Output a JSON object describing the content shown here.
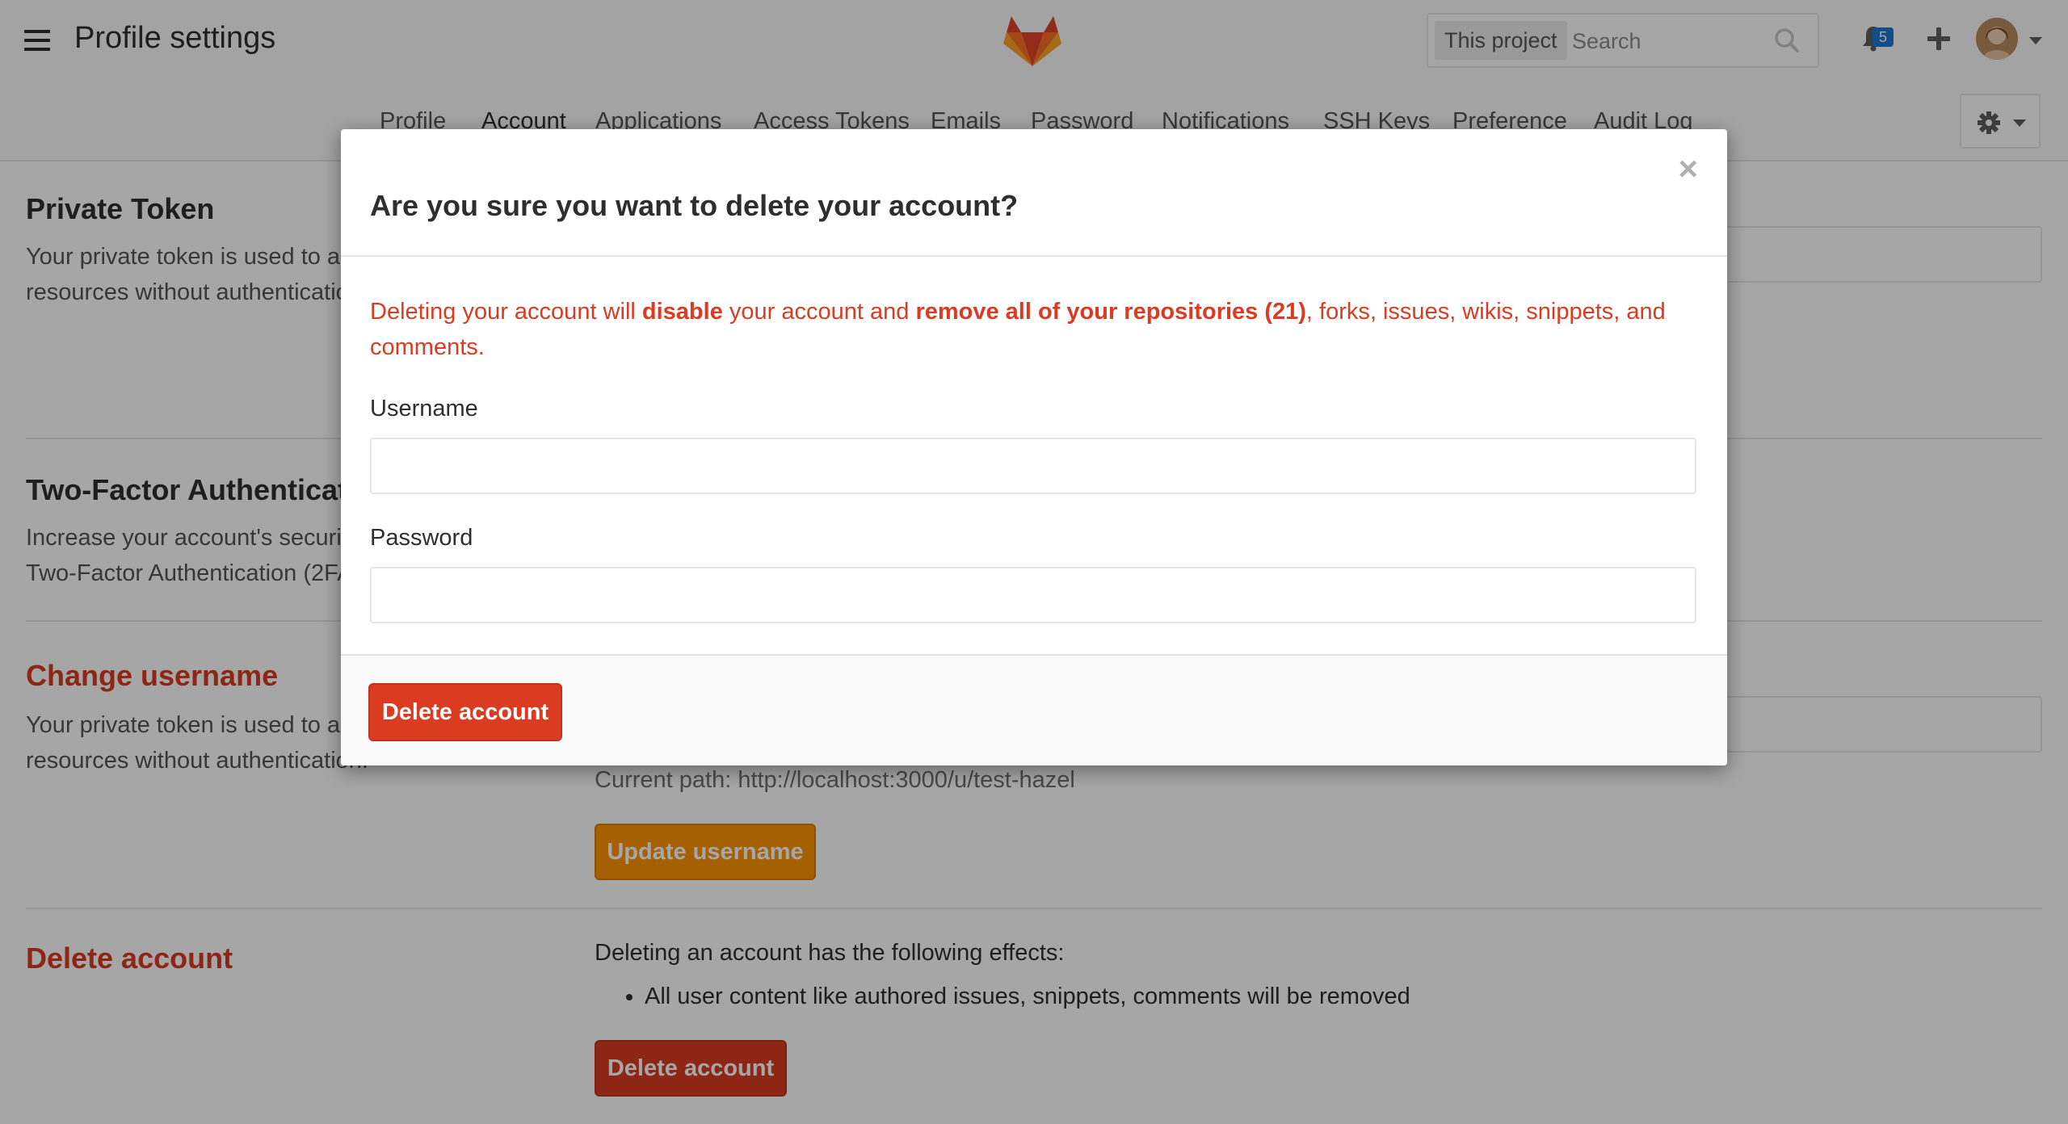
{
  "header": {
    "title": "Profile settings",
    "search": {
      "scope": "This project",
      "placeholder": "Search"
    },
    "notifications_count": "5"
  },
  "nav": {
    "tabs": [
      {
        "label": "Profile"
      },
      {
        "label": "Account",
        "active": true
      },
      {
        "label": "Applications"
      },
      {
        "label": "Access Tokens"
      },
      {
        "label": "Emails"
      },
      {
        "label": "Password"
      },
      {
        "label": "Notifications"
      },
      {
        "label": "SSH Keys"
      },
      {
        "label": "Preference"
      },
      {
        "label": "Audit Log"
      }
    ]
  },
  "sections": {
    "private_token": {
      "title": "Private Token",
      "description": "Your private token is used to access application resources without authentication."
    },
    "two_factor": {
      "title": "Two-Factor Authentication",
      "description": "Increase your account's security by enabling Two-Factor Authentication (2FA)."
    },
    "change_username": {
      "title": "Change username",
      "description": "Your private token is used to access application resources without authentication.",
      "current_path": "Current path: http://localhost:3000/u/test-hazel",
      "button": "Update username"
    },
    "delete_account": {
      "title": "Delete account",
      "effects_intro": "Deleting an account has the following effects:",
      "effects": [
        "All user content like authored issues, snippets, comments will be removed"
      ],
      "button": "Delete account"
    }
  },
  "modal": {
    "title": "Are you sure you want to delete your account?",
    "close": "×",
    "warning": {
      "part1": "Deleting your account will ",
      "bold1": "disable",
      "part2": " your account and ",
      "bold2": "remove all of your repositories (21)",
      "part3": ", forks, issues, wikis, snippets, and comments."
    },
    "username_label": "Username",
    "username_value": "",
    "password_label": "Password",
    "password_value": "",
    "button": "Delete account"
  },
  "colors": {
    "danger": "#db3b21",
    "warning_button": "#fc9403",
    "badge": "#1f78d1",
    "logo_orange": "#fc6d26",
    "logo_dark": "#e24329",
    "logo_light": "#fca326"
  },
  "icons": [
    "hamburger-icon",
    "gitlab-logo-icon",
    "search-icon",
    "bell-icon",
    "plus-icon",
    "gear-icon",
    "chevron-down-icon",
    "close-icon"
  ]
}
